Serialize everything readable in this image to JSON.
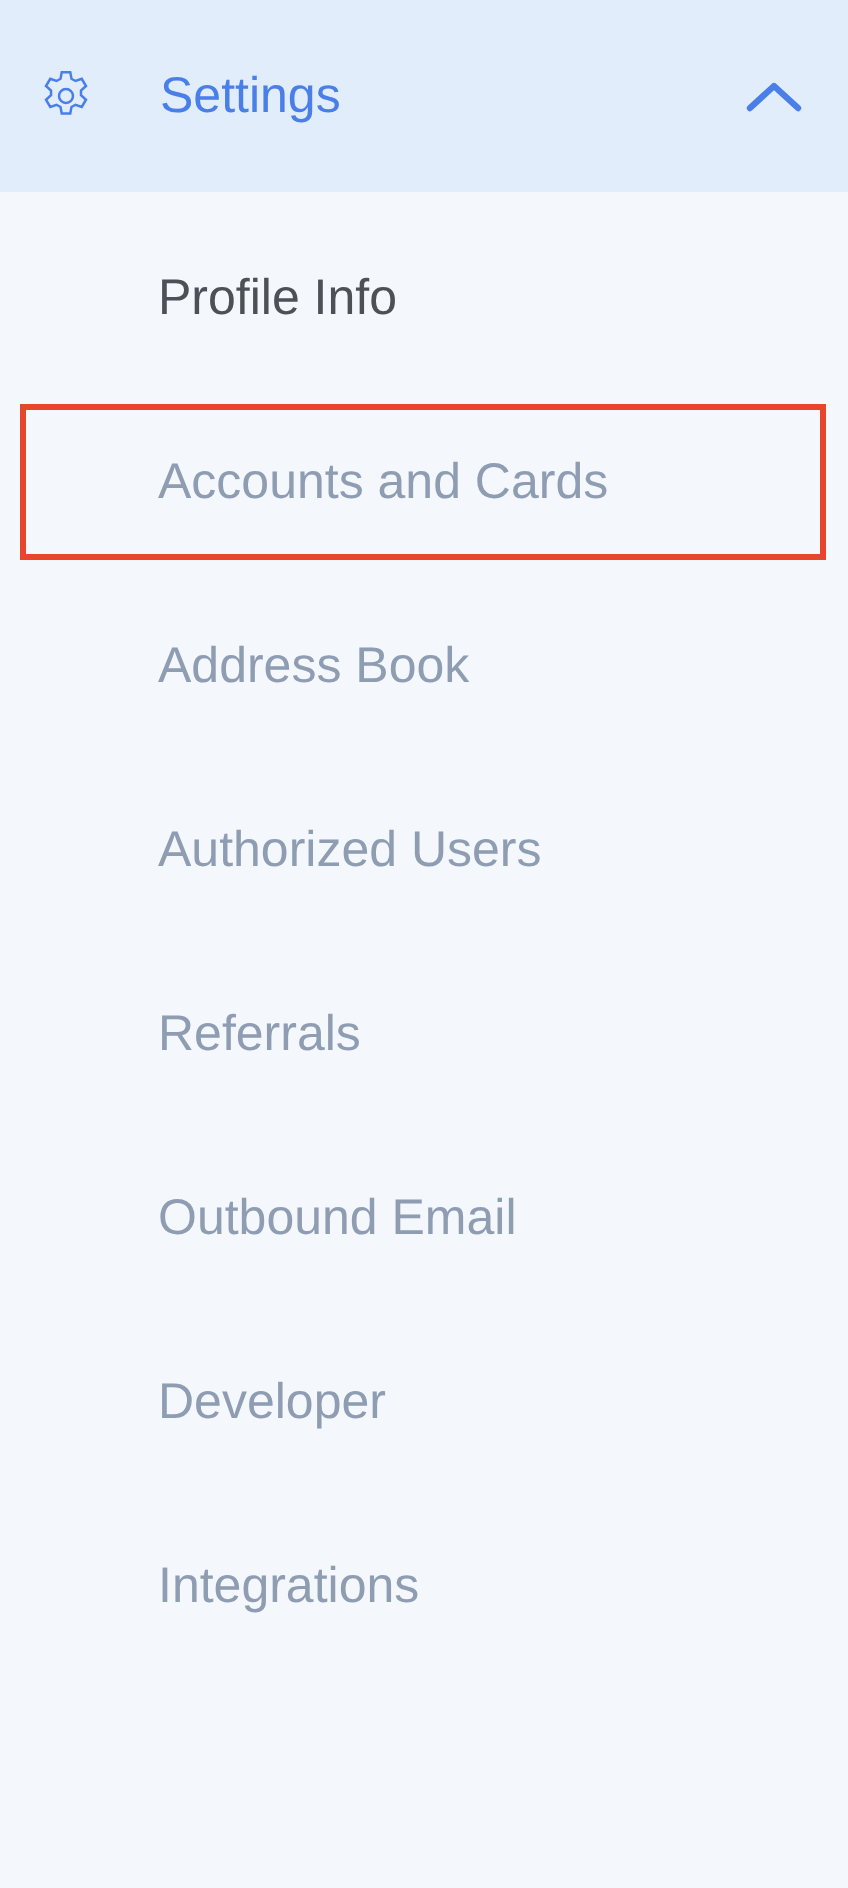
{
  "header": {
    "title": "Settings",
    "expanded": true
  },
  "items": [
    {
      "label": "Profile Info",
      "selected": true,
      "highlighted": false
    },
    {
      "label": "Accounts and Cards",
      "selected": false,
      "highlighted": true
    },
    {
      "label": "Address Book",
      "selected": false,
      "highlighted": false
    },
    {
      "label": "Authorized Users",
      "selected": false,
      "highlighted": false
    },
    {
      "label": "Referrals",
      "selected": false,
      "highlighted": false
    },
    {
      "label": "Outbound Email",
      "selected": false,
      "highlighted": false
    },
    {
      "label": "Developer",
      "selected": false,
      "highlighted": false
    },
    {
      "label": "Integrations",
      "selected": false,
      "highlighted": false
    }
  ]
}
